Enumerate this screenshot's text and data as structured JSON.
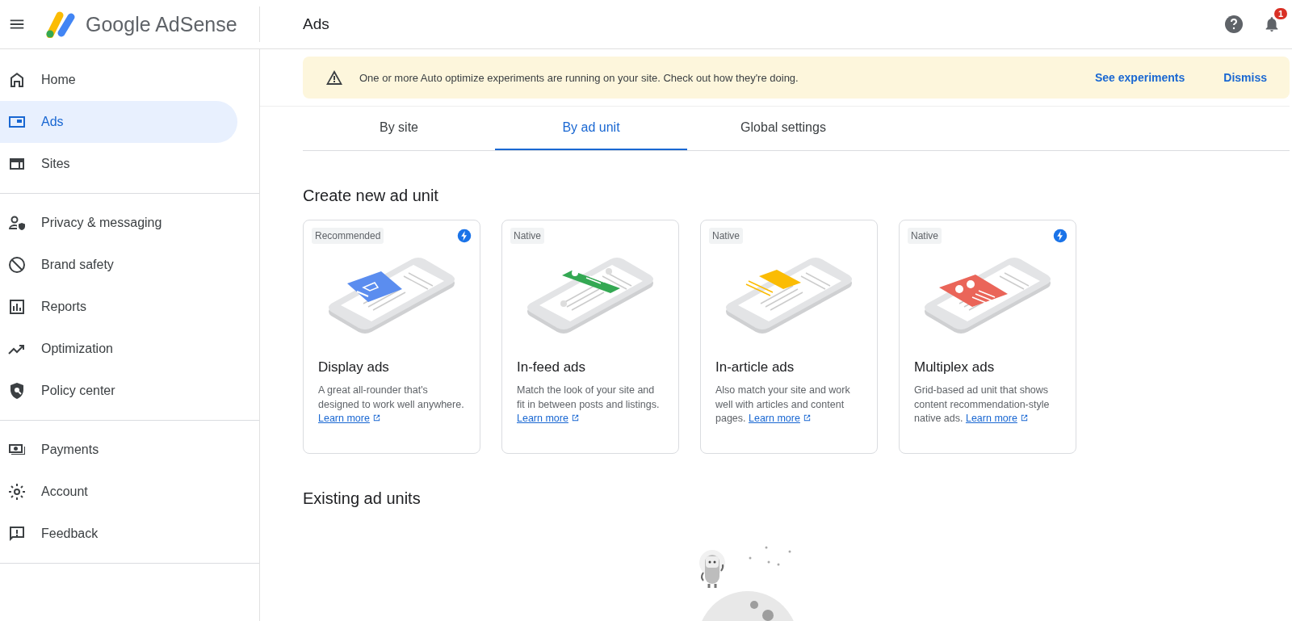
{
  "topbar": {
    "product": "Google AdSense",
    "page_title": "Ads",
    "notification_count": "1"
  },
  "sidebar": {
    "groups": [
      {
        "items": [
          {
            "label": "Home",
            "selected": false
          },
          {
            "label": "Ads",
            "selected": true
          },
          {
            "label": "Sites",
            "selected": false
          }
        ]
      },
      {
        "items": [
          {
            "label": "Privacy & messaging",
            "selected": false
          },
          {
            "label": "Brand safety",
            "selected": false
          },
          {
            "label": "Reports",
            "selected": false
          },
          {
            "label": "Optimization",
            "selected": false
          },
          {
            "label": "Policy center",
            "selected": false
          }
        ]
      },
      {
        "items": [
          {
            "label": "Payments",
            "selected": false
          },
          {
            "label": "Account",
            "selected": false
          },
          {
            "label": "Feedback",
            "selected": false
          }
        ]
      }
    ]
  },
  "banner": {
    "message": "One or more Auto optimize experiments are running on your site. Check out how they're doing.",
    "actions": [
      "See experiments",
      "Dismiss"
    ]
  },
  "tabs": [
    {
      "label": "By site",
      "selected": false
    },
    {
      "label": "By ad unit",
      "selected": true
    },
    {
      "label": "Global settings",
      "selected": false
    }
  ],
  "create_heading": "Create new ad unit",
  "cards": [
    {
      "kind": "display",
      "tag": "Recommended",
      "bolt": true,
      "color": "#5b8def",
      "title": "Display ads",
      "description": "A great all-rounder that's designed to work well anywhere.",
      "link": "Learn more"
    },
    {
      "kind": "infeed",
      "tag": "Native",
      "bolt": false,
      "color": "#34a853",
      "title": "In-feed ads",
      "description": "Match the look of your site and fit in between posts and listings.",
      "link": "Learn more"
    },
    {
      "kind": "inarticle",
      "tag": "Native",
      "bolt": false,
      "color": "#fbbc04",
      "title": "In-article ads",
      "description": "Also match your site and work well with articles and content pages.",
      "link": "Learn more"
    },
    {
      "kind": "multiplex",
      "tag": "Native",
      "bolt": true,
      "color": "#ea6559",
      "title": "Multiplex ads",
      "description": "Grid-based ad unit that shows content recommendation-style native ads.",
      "link": "Learn more"
    }
  ],
  "existing_heading": "Existing ad units"
}
